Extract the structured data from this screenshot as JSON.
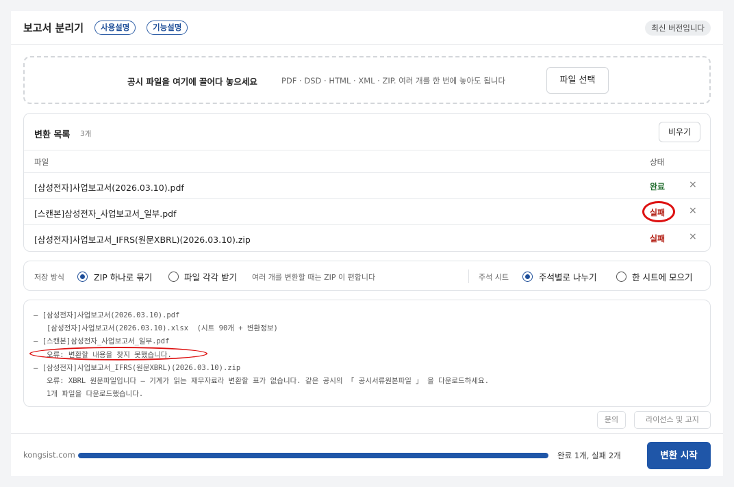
{
  "header": {
    "title": "보고서 분리기",
    "guide_label": "사용설명",
    "features_label": "기능설명",
    "version_badge": "최신 버전입니다"
  },
  "dropzone": {
    "main_text": "공시 파일을 여기에 끌어다 놓으세요",
    "sub_text": "PDF · DSD · HTML · XML · ZIP. 여러 개를 한 번에 놓아도 됩니다",
    "select_button": "파일 선택"
  },
  "list": {
    "title": "변환 목록",
    "count": "3개",
    "clear_button": "비우기",
    "col_file": "파일",
    "col_status": "상태",
    "rows": [
      {
        "name": "[삼성전자]사업보고서(2026.03.10).pdf",
        "status": "완료",
        "remove": "×"
      },
      {
        "name": "[스캔본]삼성전자_사업보고서_일부.pdf",
        "status": "실패",
        "remove": "×"
      },
      {
        "name": "[삼성전자]사업보고서_IFRS(원문XBRL)(2026.03.10).zip",
        "status": "실패",
        "remove": "×"
      }
    ]
  },
  "options": {
    "save_label": "저장 방식",
    "save_zip": "ZIP 하나로 묶기",
    "save_each": "파일 각각 받기",
    "save_hint": "여러 개를 변환할 때는 ZIP 이 편합니다",
    "notes_label": "주석 시트",
    "notes_split": "주석별로 나누기",
    "notes_merge": "한 시트에 모으기",
    "save_selected": "ZIP 하나로 묶기",
    "notes_selected": "주석별로 나누기"
  },
  "log": {
    "lines": [
      "— [삼성전자]사업보고서(2026.03.10).pdf",
      "   [삼성전자]사업보고서(2026.03.10).xlsx  (시트 90개 + 변환정보)",
      "— [스캔본]삼성전자_사업보고서_일부.pdf",
      "   오류: 변환할 내용을 찾지 못했습니다.",
      "— [삼성전자]사업보고서_IFRS(원문XBRL)(2026.03.10).zip",
      "   오류: XBRL 원문파일입니다 — 기계가 읽는 재무자료라 변환할 표가 없습니다. 같은 공시의 「 공시서류원본파일 」 을 다운로드하세요.",
      "   1개 파일을 다운로드했습니다."
    ]
  },
  "footer": {
    "contact_button": "문의",
    "license_button": "라이선스 및 고지",
    "domain": "kongsist.com",
    "progress_text": "완료 1개, 실패 2개",
    "progress_fraction": 1.0,
    "start_button": "변환 시작"
  },
  "colors": {
    "accent": "#1f56a8",
    "success": "#1f6b2c",
    "failure": "#b42318",
    "annotation": "#dd1111"
  }
}
